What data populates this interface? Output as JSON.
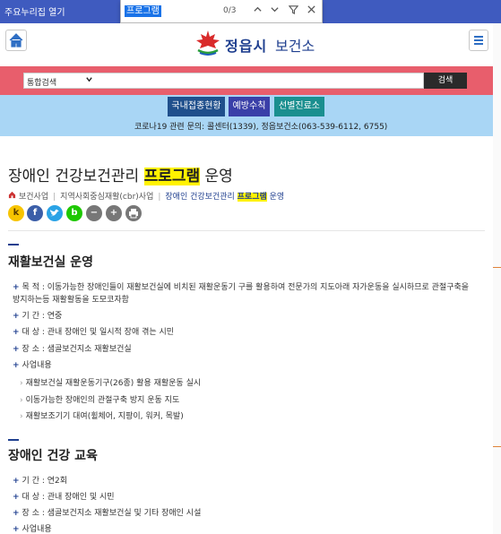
{
  "browser": {
    "skip_link": "주요누리집 열기",
    "find": {
      "query": "프로그램",
      "count": "0/3"
    }
  },
  "header": {
    "logo_city": "정읍시",
    "logo_office": "보건소"
  },
  "search": {
    "select_value": "통합검색",
    "button": "검색"
  },
  "quick_links": [
    "국내접종현황",
    "예방수칙",
    "선별진료소"
  ],
  "covid_notice": "코로나19 관련 문의: 콜센터(1339), 정읍보건소(063-539-6112, 6755)",
  "page": {
    "title_before": "장애인 건강보건관리 ",
    "title_highlight": "프로그램",
    "title_after": " 운영",
    "breadcrumb": {
      "b1": "보건사업",
      "b2": "지역사회중심재활(cbr)사업",
      "b3_before": "장애인 건강보건관리 ",
      "b3_highlight": "프로그램",
      "b3_after": " 운영"
    }
  },
  "share_icons": [
    "kakaostory-icon",
    "facebook-icon",
    "twitter-icon",
    "band-icon",
    "zoom-out-icon",
    "zoom-in-icon",
    "print-icon"
  ],
  "sections": [
    {
      "title": "재활보건실 운영",
      "purpose": "목 적 : 이동가능한 장애인들이 재활보건실에 비치된 재활운동기 구를 활용하여 전문가의 지도아래 자가운동을 실시하므로 관절구축을 방지하는등 재활활동을 도모코자함",
      "period": "기 간 : 연중",
      "target": "대 상 : 관내 장애인 및 일시적 장애 겪는 시민",
      "place": "장 소 : 샘골보건지소 재활보건실",
      "content_label": "사업내용",
      "content_items": [
        "재활보건실 재활운동기구(26종) 활용 재활운동 실시",
        "이동가능한 장애인의 관절구축 방지 운동 지도",
        "재활보조기기 대여(휠체어, 지팡이, 워커, 목발)"
      ]
    },
    {
      "title": "장애인 건강 교육",
      "period": "기 간 : 연2회",
      "target": "대 상 : 관내 장애인 및 시민",
      "place": "장 소 : 샘골보건지소 재활보건실 및 기타 장애인 시설",
      "content_label": "사업내용"
    }
  ]
}
